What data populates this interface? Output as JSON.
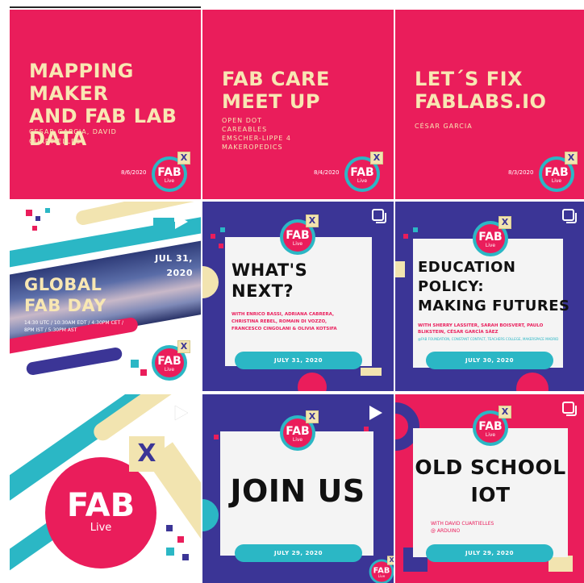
{
  "posts": [
    {
      "title_lines": [
        "MAPPING MAKER",
        "AND FAB LAB",
        "DATA"
      ],
      "subtitle_lines": [
        "CESAR GARCIA, DAVID",
        "CUARTIELLES"
      ],
      "date": "8/6/2020"
    },
    {
      "title_lines": [
        "FAB CARE",
        "MEET UP"
      ],
      "subtitle_lines": [
        "OPEN DOT",
        "CAREABLES",
        "EMSCHER-LIPPE 4",
        "MAKEROPEDICS"
      ],
      "date": "8/4/2020"
    },
    {
      "title_lines": [
        "LET´S FIX",
        "FABLABS.IO"
      ],
      "subtitle_lines": [
        "CÉSAR GARCIA"
      ],
      "date": "8/3/2020"
    },
    {
      "date_lines": [
        "JUL 31,",
        "2020"
      ],
      "title_lines": [
        "GLOBAL",
        "FAB DAY"
      ],
      "time_lines": [
        "14:30 UTC / 10:30AM EDT / 4:30PM CET /",
        "8PM IST / 5:30PM AST"
      ]
    },
    {
      "title_lines": [
        "WHAT'S",
        "NEXT?"
      ],
      "subtitle_lines": [
        "WITH ENRICO BASSI, ADRIANA CABRERA,",
        "CHRISTINA REBEL, ROMAIN DI VOZZO,",
        "FRANCESCO CINGOLANI & OLIVIA KOTSIFA"
      ],
      "date": "JULY 31, 2020"
    },
    {
      "title_lines": [
        "EDUCATION",
        "POLICY:",
        "MAKING FUTURES"
      ],
      "subtitle_lines": [
        "WITH SHERRY LASSITER, SARAH BOISVERT, PAULO",
        "BLIKSTEIN, CÉSAR GARCÍA SÁEZ"
      ],
      "orgs": "@FAB FOUNDATION, CONSTANT CONTACT, TEACHERS COLLEGE, MAKERSPACE MADRID",
      "date": "JULY 30, 2020"
    },
    {
      "badge_fab": "FAB",
      "badge_live": "Live",
      "badge_x": "X"
    },
    {
      "title": "JOIN US",
      "date": "JULY 29, 2020"
    },
    {
      "title_lines": [
        "OLD SCHOOL",
        "IOT"
      ],
      "subtitle_lines": [
        "WITH DAVID CUARTIELLES",
        "@ ARDUINO"
      ],
      "date": "JULY 29, 2020"
    }
  ],
  "badge": {
    "fab": "FAB",
    "live": "Live",
    "x": "X"
  },
  "colors": {
    "pink": "#ea1d5b",
    "navy": "#3b3596",
    "teal": "#2bb7c5",
    "cream": "#f2e4b0"
  }
}
